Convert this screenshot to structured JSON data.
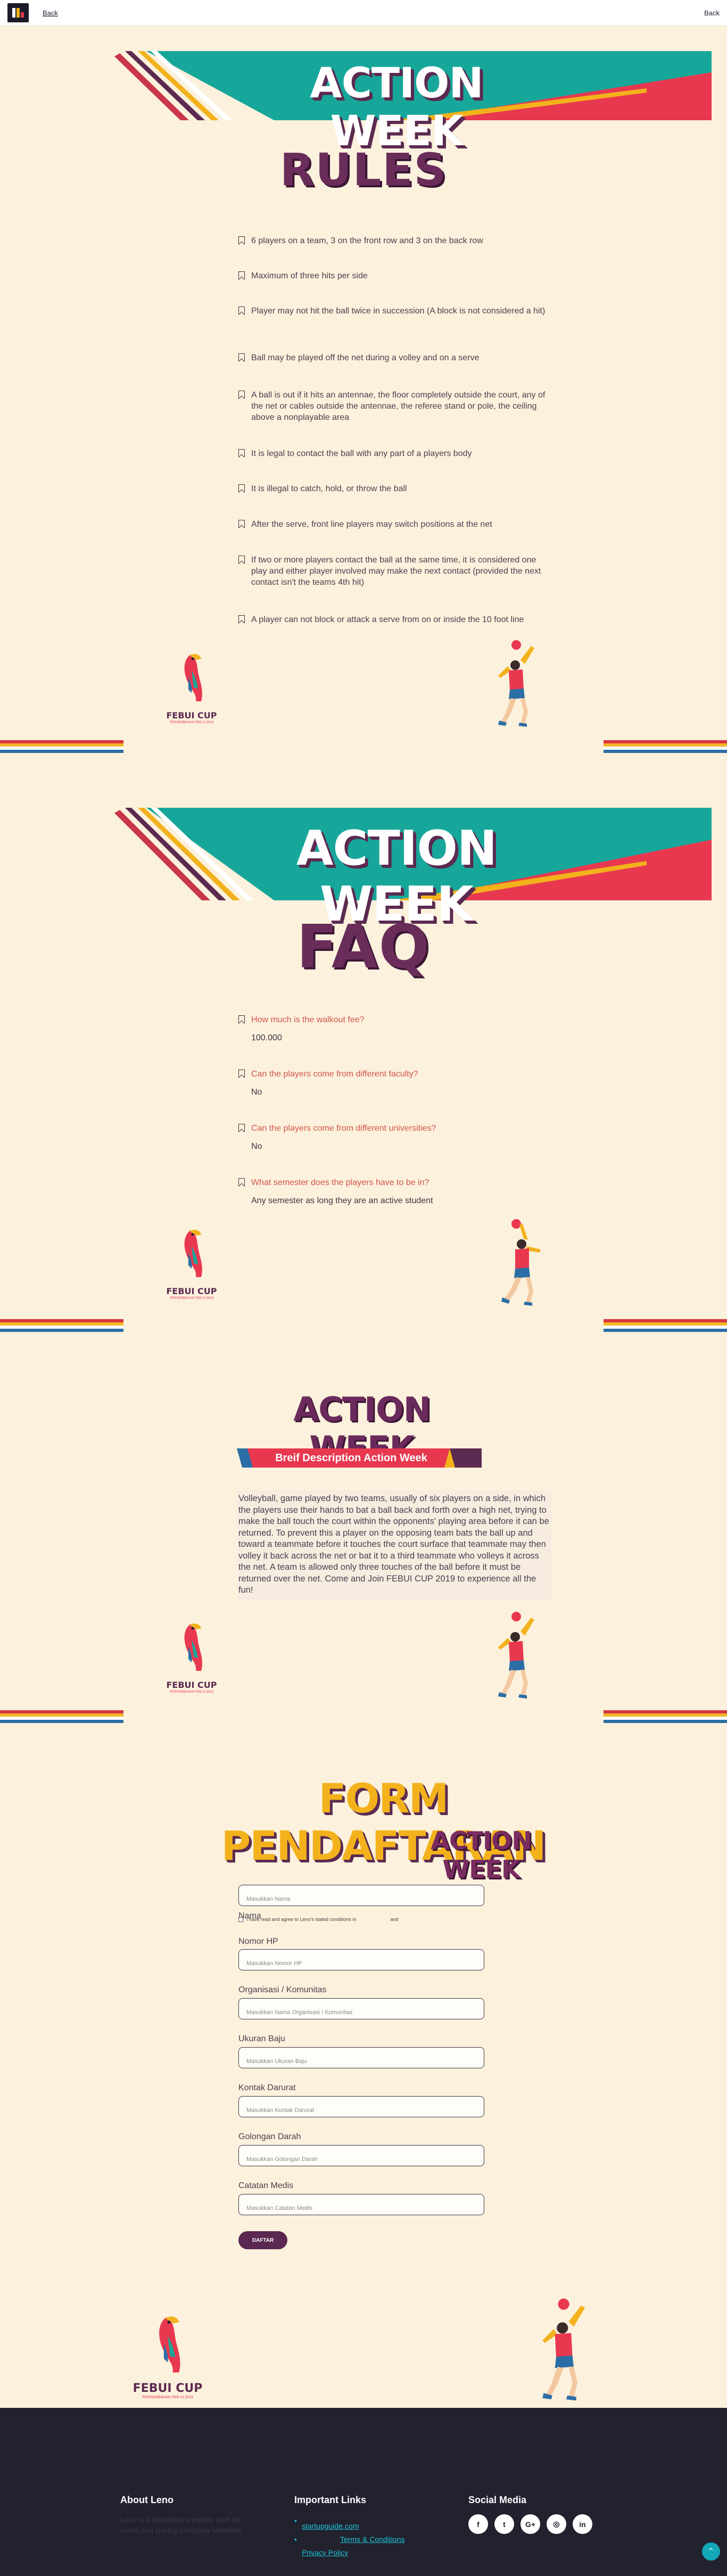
{
  "nav": {
    "back_label": "Back",
    "right_label": "Back"
  },
  "banners": [
    {
      "title": "ACTION WEEK"
    },
    {
      "title": "ACTION WEEK"
    }
  ],
  "rules": {
    "heading": "RULES",
    "items": [
      "6 players on a team, 3 on the front row and 3 on the back row",
      "Maximum of three hits per side",
      "Player may not hit the ball twice in succession (A block is not considered a hit)",
      "Ball may be played off the net during a volley and on a serve",
      "A ball is out if it hits an antennae, the floor completely outside the court, any of the net or cables outside the antennae, the referee stand or pole, the ceiling above a nonplayable area",
      "It is legal to contact the ball with any part of a players body",
      "It is illegal to catch, hold, or throw the ball",
      "After the serve, front line players may switch positions at the net",
      "If two or more players contact the ball at the same time, it is considered one play and either player involved may make the next contact (provided the next contact isn't the teams 4th hit)",
      "A player can not block or attack a serve from on or inside the 10 foot line"
    ]
  },
  "faq": {
    "heading": "FAQ",
    "items": [
      {
        "q": "How much is the walkout fee?",
        "a": "100.000"
      },
      {
        "q": "Can the players come from different faculty?",
        "a": "No"
      },
      {
        "q": "Can the players come from different universities?",
        "a": "No"
      },
      {
        "q": "What semester does the players have to be in?",
        "a": "Any semester as long they are an active student"
      }
    ]
  },
  "brief": {
    "title": "ACTION WEEK",
    "ribbon": "Breif Description Action Week",
    "body": "Volleyball, game played by two teams, usually of six players on a side, in which the players use their hands to bat a ball back and forth over a high net, trying to make the ball touch the court within the opponents' playing area before it can be returned. To prevent this a player on the opposing team bats the ball up and toward a teammate before it touches the court surface that teammate may then volley it back across the net or bat it to a third teammate who volleys it across the net. A team is allowed only three touches of the ball before it must be returned over the net. Come and Join FEBUI CUP 2019 to experience all the fun!"
  },
  "mascot": {
    "label": "FEBUI CUP",
    "sub": "PERSEMBAHAN FEB UI 2019"
  },
  "form": {
    "title": "FORM PENDAFTARAN",
    "subtitle": "ACTION WEEK",
    "agree_text": "I have read and agree to Leno's stated conditions in",
    "agree_and": "and",
    "fields": [
      {
        "label": "Nama",
        "placeholder": "Masukkan Nama"
      },
      {
        "label": "Nomor HP",
        "placeholder": "Masukkan Nomor HP"
      },
      {
        "label": "Organisasi / Komunitas",
        "placeholder": "Masukkan Nama Organisasi / Komunitas"
      },
      {
        "label": "Ukuran Baju",
        "placeholder": "Masukkan Ukuran Baju"
      },
      {
        "label": "Kontak Darurat",
        "placeholder": "Masukkan Kontak Darurat"
      },
      {
        "label": "Golongan Darah",
        "placeholder": "Masukkan Golongan Darah"
      },
      {
        "label": "Catatan Medis",
        "placeholder": "Masukkan Catatan Medis"
      }
    ],
    "submit": "DAFTAR"
  },
  "footer": {
    "about_head": "About Leno",
    "about_text": "Leno is a bootstrap template built for event and startup company websites",
    "links_head": "Important Links",
    "links": [
      "startupguide.com",
      "Terms & Conditions",
      "Privacy Policy"
    ],
    "social_head": "Social Media",
    "social_icons": [
      "facebook-icon",
      "twitter-icon",
      "google-plus-icon",
      "instagram-icon",
      "linkedin-icon"
    ],
    "social_glyphs": [
      "f",
      "t",
      "G+",
      "◎",
      "in"
    ]
  },
  "colors": {
    "background": "#fcf1dc",
    "teal": "#17a79a",
    "red": "#e8384f",
    "yellow": "#f3b21c",
    "plum": "#5b2a50",
    "footer": "#22212e",
    "link": "#1dc6d6"
  }
}
